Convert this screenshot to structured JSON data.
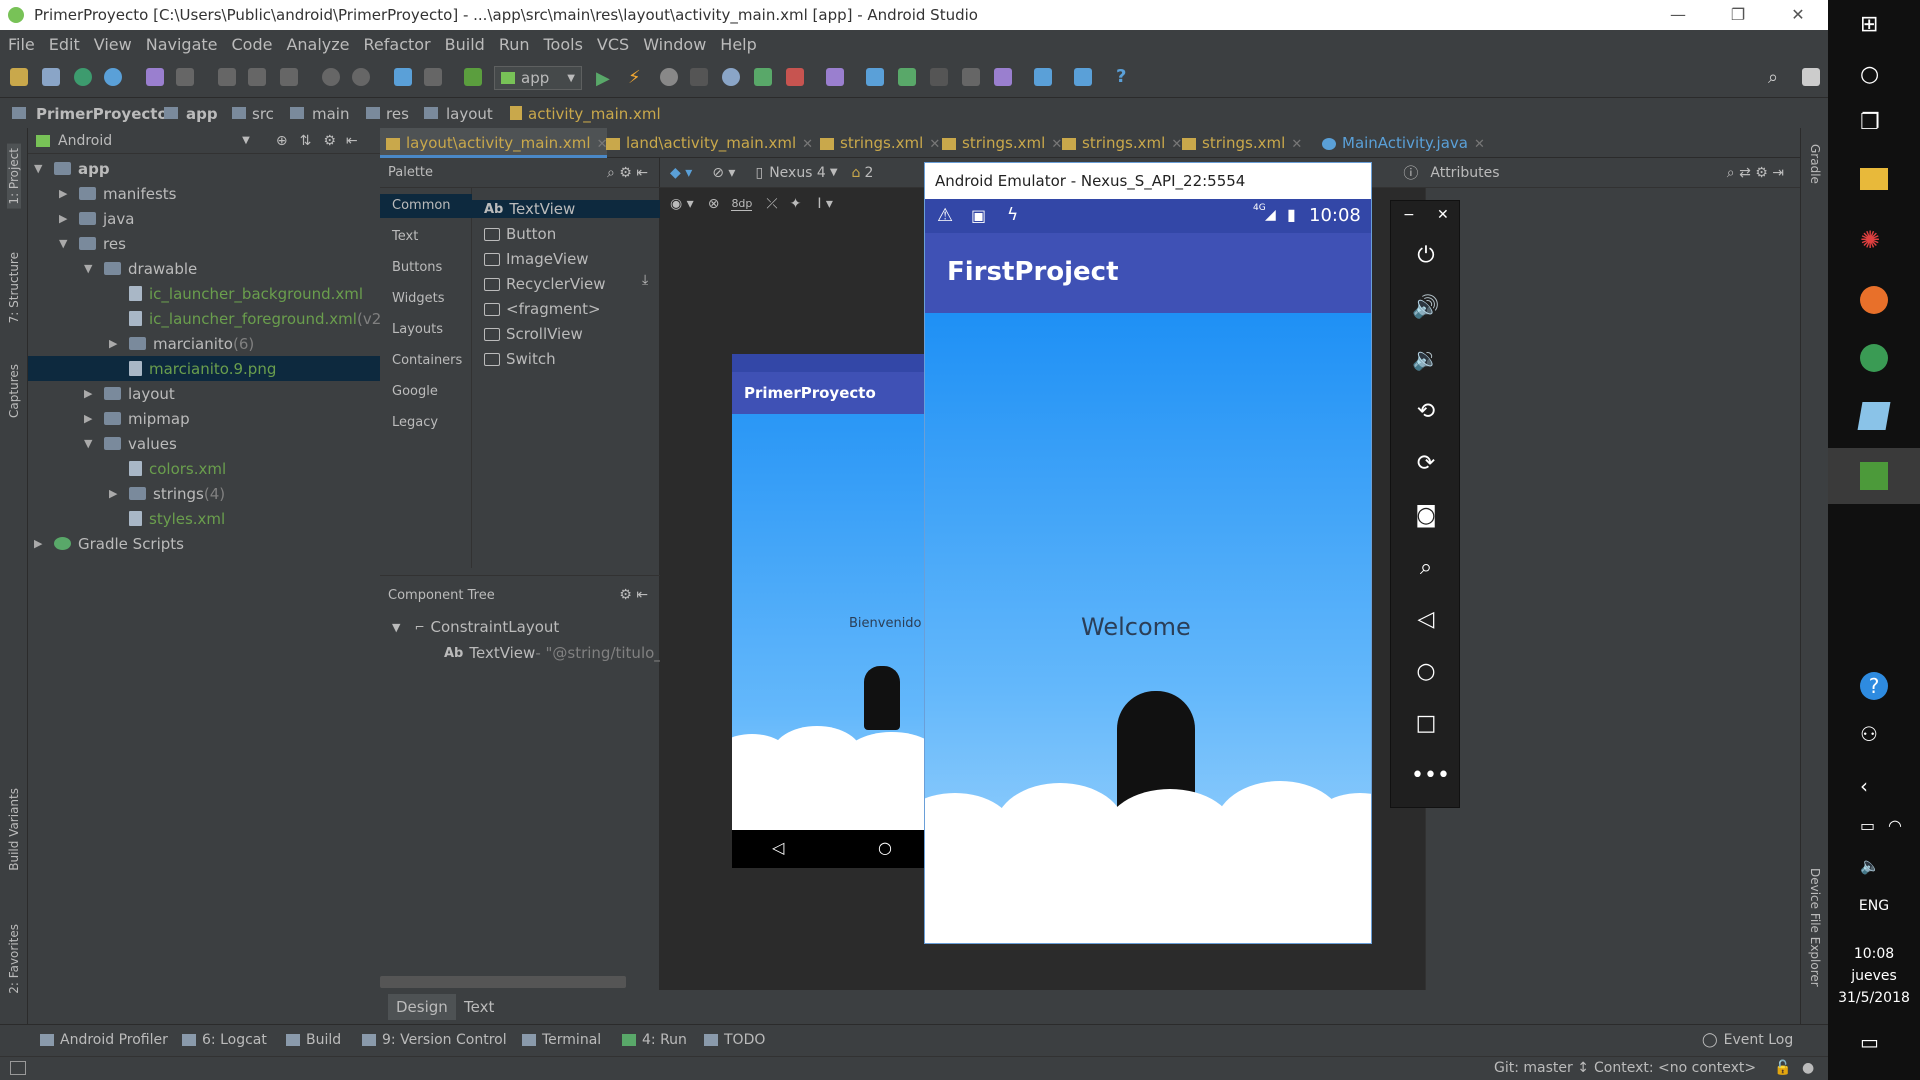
{
  "window": {
    "title": "PrimerProyecto [C:\\Users\\Public\\android\\PrimerProyecto] - ...\\app\\src\\main\\res\\layout\\activity_main.xml [app] - Android Studio",
    "minimize": "—",
    "maximize": "❐",
    "close": "✕"
  },
  "menu": [
    "File",
    "Edit",
    "View",
    "Navigate",
    "Code",
    "Analyze",
    "Refactor",
    "Build",
    "Run",
    "Tools",
    "VCS",
    "Window",
    "Help"
  ],
  "toolbar": {
    "run_config": "app"
  },
  "breadcrumb": [
    "PrimerProyecto",
    "app",
    "src",
    "main",
    "res",
    "layout",
    "activity_main.xml"
  ],
  "project_panel": {
    "view_mode": "Android",
    "tree": [
      {
        "label": "app",
        "level": 0,
        "kind": "folder",
        "arrow": "▼"
      },
      {
        "label": "manifests",
        "level": 1,
        "kind": "folder",
        "arrow": "▶"
      },
      {
        "label": "java",
        "level": 1,
        "kind": "folder",
        "arrow": "▶"
      },
      {
        "label": "res",
        "level": 1,
        "kind": "folder",
        "arrow": "▼"
      },
      {
        "label": "drawable",
        "level": 2,
        "kind": "folder",
        "arrow": "▼"
      },
      {
        "label": "ic_launcher_background.xml",
        "level": 3,
        "kind": "file",
        "arrow": ""
      },
      {
        "label": "ic_launcher_foreground.xml",
        "suffix": " (v24)",
        "level": 3,
        "kind": "file",
        "arrow": ""
      },
      {
        "label": "marcianito",
        "suffix": " (6)",
        "level": 3,
        "kind": "folder",
        "arrow": "▶"
      },
      {
        "label": "marcianito.9.png",
        "level": 3,
        "kind": "file",
        "arrow": "",
        "selected": true
      },
      {
        "label": "layout",
        "level": 2,
        "kind": "folder",
        "arrow": "▶"
      },
      {
        "label": "mipmap",
        "level": 2,
        "kind": "folder",
        "arrow": "▶"
      },
      {
        "label": "values",
        "level": 2,
        "kind": "folder",
        "arrow": "▼"
      },
      {
        "label": "colors.xml",
        "level": 3,
        "kind": "file",
        "arrow": ""
      },
      {
        "label": "strings",
        "suffix": " (4)",
        "level": 3,
        "kind": "folder",
        "arrow": "▶"
      },
      {
        "label": "styles.xml",
        "level": 3,
        "kind": "file",
        "arrow": ""
      },
      {
        "label": "Gradle Scripts",
        "level": 0,
        "kind": "gradle",
        "arrow": "▶"
      }
    ]
  },
  "left_tool_windows": [
    "1: Project",
    "7: Structure",
    "Captures",
    "Build Variants",
    "2: Favorites"
  ],
  "right_tool_windows": [
    "Gradle",
    "Device File Explorer"
  ],
  "editor_tabs": [
    {
      "label": "layout\\activity_main.xml",
      "active": true
    },
    {
      "label": "land\\activity_main.xml",
      "active": false
    },
    {
      "label": "strings.xml",
      "active": false
    },
    {
      "label": "strings.xml",
      "active": false
    },
    {
      "label": "strings.xml",
      "active": false
    },
    {
      "label": "strings.xml",
      "active": false
    },
    {
      "label": "MainActivity.java",
      "active": false
    }
  ],
  "palette": {
    "title": "Palette",
    "categories": [
      "Common",
      "Text",
      "Buttons",
      "Widgets",
      "Layouts",
      "Containers",
      "Google",
      "Legacy"
    ],
    "items": [
      "TextView",
      "Button",
      "ImageView",
      "RecyclerView",
      "<fragment>",
      "ScrollView",
      "Switch"
    ],
    "textview_prefix": "Ab"
  },
  "component_tree": {
    "title": "Component Tree",
    "root": "ConstraintLayout",
    "child_prefix": "Ab",
    "child": "TextView",
    "child_value": " - \"@string/titulo_ap"
  },
  "design_toolbar": {
    "device": "Nexus 4",
    "margin": "8dp",
    "api": "2"
  },
  "attributes_title": "Attributes",
  "preview": {
    "app_title": "PrimerProyecto",
    "text": "Bienvenido"
  },
  "emulator": {
    "title": "Android Emulator - Nexus_S_API_22:5554",
    "time": "10:08",
    "network": "4G",
    "app_title": "FirstProject",
    "text": "Welcome",
    "close": "✕",
    "minimize": "−"
  },
  "bottom_tabs": [
    "Design",
    "Text"
  ],
  "tool_windows_bottom": [
    "Android Profiler",
    "6: Logcat",
    "Build",
    "9: Version Control",
    "Terminal",
    "4: Run",
    "TODO"
  ],
  "event_log": "Event Log",
  "status": {
    "git": "Git: master ↕",
    "context": "Context: <no context>"
  },
  "taskbar": {
    "lang": "ENG",
    "time": "10:08",
    "day": "jueves",
    "date": "31/5/2018"
  },
  "colors": {
    "accent": "#4a88c7",
    "appbar": "#3f51b5",
    "sky": "#1e90f5",
    "ide_bg": "#3c3f41"
  }
}
